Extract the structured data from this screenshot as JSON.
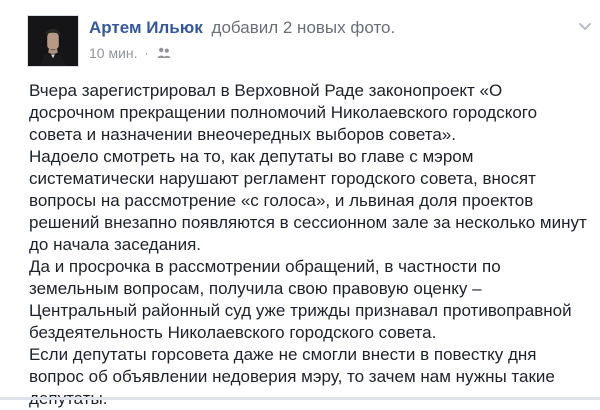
{
  "header": {
    "author_name": "Артем Ильюк",
    "action_text": "добавил 2 новых фото.",
    "time_text": "10 мин.",
    "separator": "·",
    "avatar_icon": "avatar-portrait-icon",
    "audience_icon": "friends-icon",
    "menu_icon": "chevron-down-icon"
  },
  "post": {
    "paragraphs": [
      "Вчера зарегистрировал в Верховной Раде законопроект «О досрочном прекращении полномочий Николаевского городского совета и назначении внеочередных выборов совета».",
      "Надоело смотреть на то, как депутаты во главе с мэром систематически нарушают регламент городского совета, вносят вопросы на рассмотрение «с голоса», и львиная доля проектов решений внезапно появляются в сессионном зале за несколько минут до начала заседания.",
      "Да и просрочка в рассмотрении обращений, в частности по земельным вопросам, получила свою правовую оценку – Центральный районный суд уже трижды признавал противоправной бездеятельность Николаевского городского совета.",
      "Если депутаты горсовета даже не смогли внести в повестку дня вопрос об объявлении недоверия мэру, то зачем нам нужны такие депутаты."
    ]
  },
  "colors": {
    "author": "#365899",
    "body_text": "#1d2129",
    "meta_text": "#90949c",
    "background": "#ffffff"
  }
}
